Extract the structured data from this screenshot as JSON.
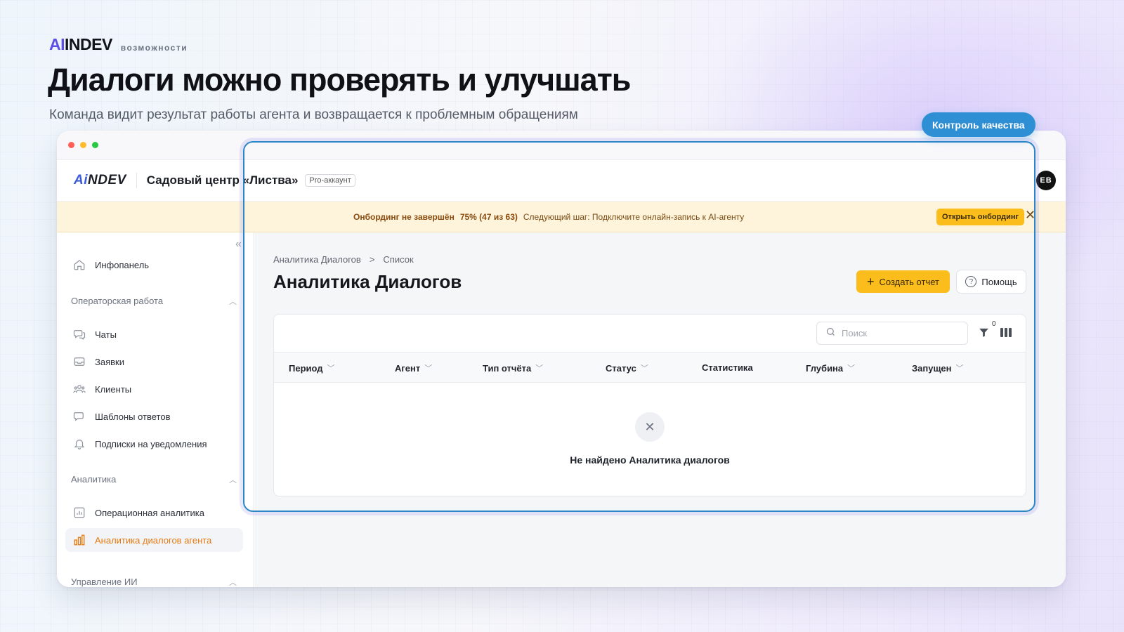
{
  "brand": {
    "logo_ai": "AI",
    "logo_rest": "INDEV",
    "tag": "возможности"
  },
  "hero": {
    "title": "Диалоги можно проверять и улучшать",
    "subtitle": "Команда видит результат работы агента и возвращается к проблемным обращениям"
  },
  "badge": {
    "label": "Контроль качества"
  },
  "app": {
    "logo_ai": "Ai",
    "logo_rest": "NDEV",
    "org_name": "Садовый центр «Листва»",
    "plan": "Pro-аккаунт",
    "avatar_initials": "EB"
  },
  "onboarding": {
    "title": "Онбординг не завершён",
    "progress": "75% (47 из 63)",
    "next": "Следующий шаг: Подключите онлайн-запись к AI-агенту",
    "button": "Открыть онбординг",
    "close": "✕"
  },
  "sidebar": {
    "collapse_icon": "«",
    "top_item": "Инфопанель",
    "sections": [
      {
        "title": "Операторская работа",
        "items": [
          "Чаты",
          "Заявки",
          "Клиенты",
          "Шаблоны ответов",
          "Подписки на уведомления"
        ]
      },
      {
        "title": "Аналитика",
        "items": [
          "Операционная аналитика",
          "Аналитика диалогов агента"
        ]
      },
      {
        "title": "Управление ИИ",
        "items": []
      }
    ],
    "active_item": "Аналитика диалогов агента"
  },
  "main": {
    "breadcrumbs": [
      "Аналитика Диалогов",
      "Список"
    ],
    "breadcrumb_sep": ">",
    "title": "Аналитика Диалогов",
    "create_button": "Создать отчет",
    "help_button": "Помощь",
    "search_placeholder": "Поиск",
    "filter_count": "0",
    "columns": [
      "Период",
      "Агент",
      "Тип отчёта",
      "Статус",
      "Статистика",
      "Глубина",
      "Запущен"
    ],
    "empty_text": "Не найдено Аналитика диалогов"
  },
  "colors": {
    "accent": "#fbbd1c",
    "active_nav": "#e57a10",
    "highlight_border": "#2a86c6",
    "badge_bg": "#2f8fd4"
  }
}
